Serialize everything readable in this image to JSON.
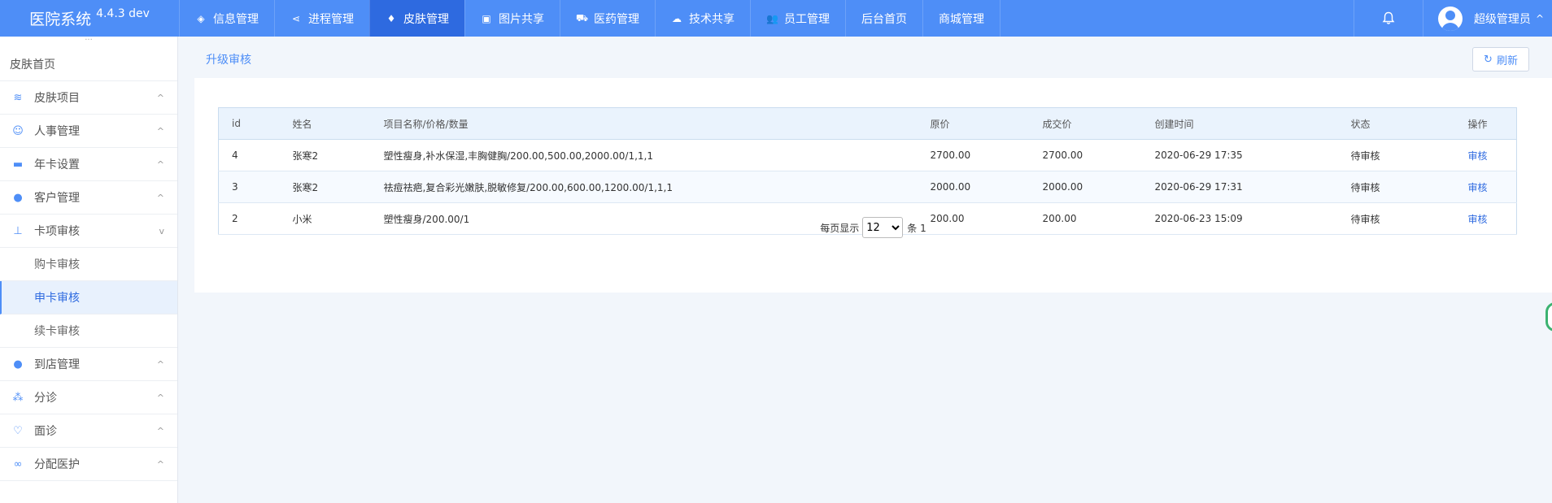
{
  "app": {
    "title": "医院系统",
    "version": "4.4.3 dev"
  },
  "topnav": [
    {
      "label": "信息管理",
      "icon": "cube-icon",
      "glyph": "◈",
      "active": false
    },
    {
      "label": "进程管理",
      "icon": "share-icon",
      "glyph": "⋖",
      "active": false
    },
    {
      "label": "皮肤管理",
      "icon": "diamond-icon",
      "glyph": "♦",
      "active": true
    },
    {
      "label": "图片共享",
      "icon": "image-icon",
      "glyph": "▣",
      "active": false
    },
    {
      "label": "医药管理",
      "icon": "cart-icon",
      "glyph": "⛟",
      "active": false
    },
    {
      "label": "技术共享",
      "icon": "cloud-upload-icon",
      "glyph": "☁",
      "active": false
    },
    {
      "label": "员工管理",
      "icon": "users-icon",
      "glyph": "👥",
      "active": false
    },
    {
      "label": "后台首页",
      "icon": "",
      "glyph": "",
      "active": false
    },
    {
      "label": "商城管理",
      "icon": "",
      "glyph": "",
      "active": false
    }
  ],
  "user": {
    "name": "超级管理员",
    "caret": "^"
  },
  "sidebar": {
    "dots": "···",
    "home": "皮肤首页",
    "groups": [
      {
        "label": "皮肤项目",
        "icon": "layers-icon",
        "glyph": "≋",
        "caret": "^"
      },
      {
        "label": "人事管理",
        "icon": "smile-icon",
        "glyph": "☺",
        "caret": "^"
      },
      {
        "label": "年卡设置",
        "icon": "folder-icon",
        "glyph": "▬",
        "caret": "^"
      },
      {
        "label": "客户管理",
        "icon": "user-gear-icon",
        "glyph": "●",
        "caret": "^"
      },
      {
        "label": "卡项审核",
        "icon": "stamp-icon",
        "glyph": "⊥",
        "caret": "v",
        "expanded": true
      }
    ],
    "sub_items": [
      {
        "label": "购卡审核",
        "active": false
      },
      {
        "label": "申卡审核",
        "active": true
      },
      {
        "label": "续卡审核",
        "active": false
      }
    ],
    "groups_after": [
      {
        "label": "到店管理",
        "icon": "user-gear-icon",
        "glyph": "●",
        "caret": "^"
      },
      {
        "label": "分诊",
        "icon": "triage-icon",
        "glyph": "⁂",
        "caret": "^"
      },
      {
        "label": "面诊",
        "icon": "heart-icon",
        "glyph": "♡",
        "caret": "^"
      },
      {
        "label": "分配医护",
        "icon": "link-icon",
        "glyph": "∞",
        "caret": "^"
      }
    ]
  },
  "main": {
    "breadcrumb": "升级审核",
    "refresh_label": "刷新",
    "refresh_glyph": "↻",
    "table": {
      "columns": [
        "id",
        "姓名",
        "项目名称/价格/数量",
        "原价",
        "成交价",
        "创建时间",
        "状态",
        "操作"
      ],
      "rows": [
        {
          "id": "4",
          "name": "张寒2",
          "items": "塑性瘦身,补水保湿,丰胸健胸/200.00,500.00,2000.00/1,1,1",
          "original_price": "2700.00",
          "deal_price": "2700.00",
          "created": "2020-06-29 17:35",
          "status": "待审核",
          "action": "审核"
        },
        {
          "id": "3",
          "name": "张寒2",
          "items": "祛痘祛疤,复合彩光嫩肤,脱敏修复/200.00,600.00,1200.00/1,1,1",
          "original_price": "2000.00",
          "deal_price": "2000.00",
          "created": "2020-06-29 17:31",
          "status": "待审核",
          "action": "审核"
        },
        {
          "id": "2",
          "name": "小米",
          "items": "塑性瘦身/200.00/1",
          "original_price": "200.00",
          "deal_price": "200.00",
          "created": "2020-06-23 15:09",
          "status": "待审核",
          "action": "审核"
        }
      ]
    },
    "pager": {
      "per_page_label": "每页显示",
      "per_page_value": "12",
      "per_page_options": [
        "12"
      ],
      "total_label": "条 1"
    }
  },
  "colors": {
    "accent": "#4e8ef7",
    "active_nav": "#2e6ae0",
    "background": "#f2f6fb"
  }
}
